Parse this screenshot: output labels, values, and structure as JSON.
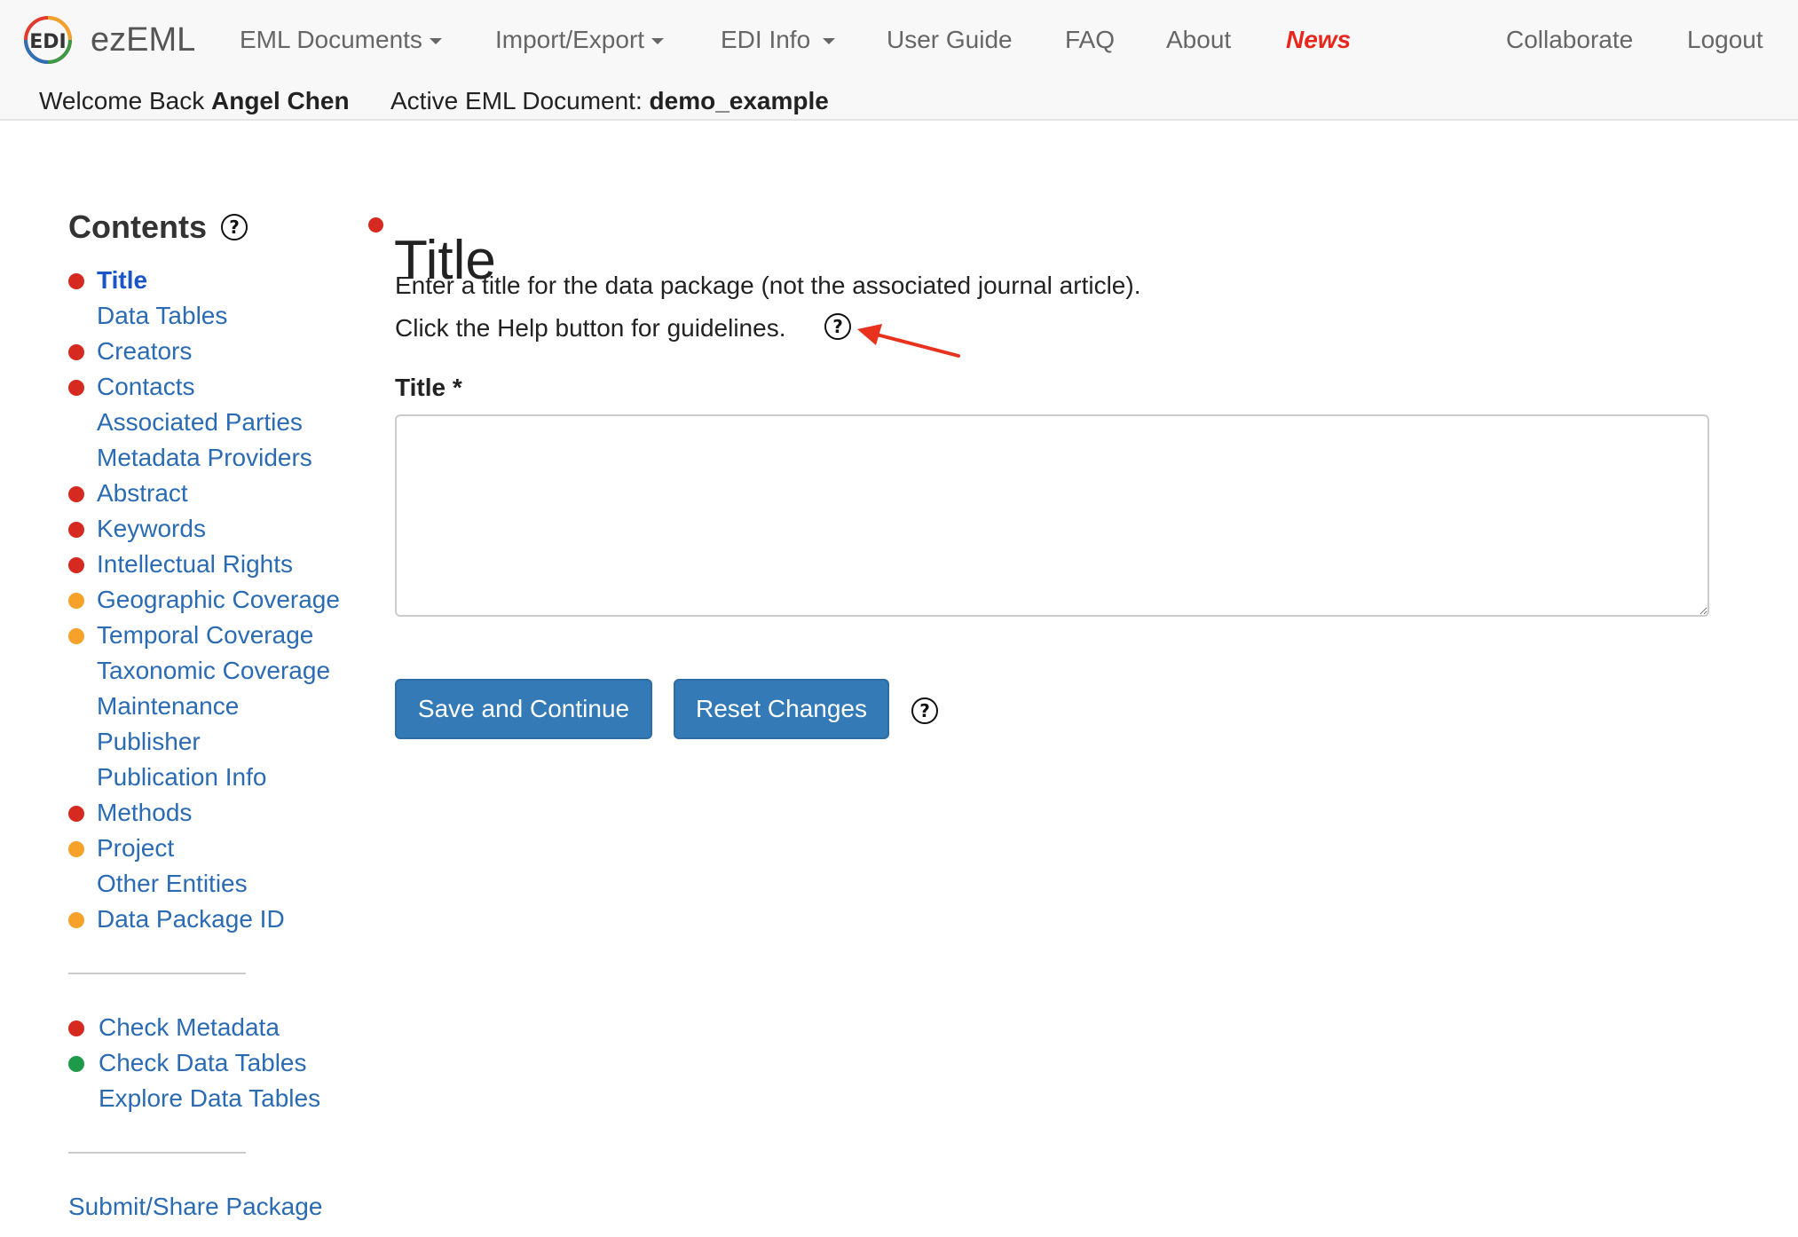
{
  "app": {
    "brand_name": "ezEML",
    "logo_text": "EDI"
  },
  "nav": {
    "eml_documents": "EML Documents",
    "import_export": "Import/Export",
    "edi_info": "EDI Info",
    "user_guide": "User Guide",
    "faq": "FAQ",
    "about": "About",
    "news": "News",
    "collaborate": "Collaborate",
    "logout": "Logout"
  },
  "session": {
    "welcome_prefix": "Welcome Back",
    "user_name": "Angel Chen",
    "active_doc_prefix": "Active EML Document:",
    "active_doc_name": "demo_example"
  },
  "sidebar": {
    "title": "Contents",
    "items": [
      {
        "label": "Title",
        "status": "red",
        "active": true
      },
      {
        "label": "Data Tables",
        "status": "none"
      },
      {
        "label": "Creators",
        "status": "red"
      },
      {
        "label": "Contacts",
        "status": "red"
      },
      {
        "label": "Associated Parties",
        "status": "none"
      },
      {
        "label": "Metadata Providers",
        "status": "none"
      },
      {
        "label": "Abstract",
        "status": "red"
      },
      {
        "label": "Keywords",
        "status": "red"
      },
      {
        "label": "Intellectual Rights",
        "status": "red"
      },
      {
        "label": "Geographic Coverage",
        "status": "orange"
      },
      {
        "label": "Temporal Coverage",
        "status": "orange"
      },
      {
        "label": "Taxonomic Coverage",
        "status": "none"
      },
      {
        "label": "Maintenance",
        "status": "none"
      },
      {
        "label": "Publisher",
        "status": "none"
      },
      {
        "label": "Publication Info",
        "status": "none"
      },
      {
        "label": "Methods",
        "status": "red"
      },
      {
        "label": "Project",
        "status": "orange"
      },
      {
        "label": "Other Entities",
        "status": "none"
      },
      {
        "label": "Data Package ID",
        "status": "orange"
      }
    ],
    "checks": [
      {
        "label": "Check Metadata",
        "status": "red"
      },
      {
        "label": "Check Data Tables",
        "status": "green"
      },
      {
        "label": "Explore Data Tables",
        "status": "none"
      }
    ],
    "submit_label": "Submit/Share Package"
  },
  "main": {
    "page_title": "Title",
    "instruction_1": "Enter a title for the data package (not the associated journal article).",
    "instruction_2": "Click the Help button for guidelines.",
    "field_label": "Title *",
    "title_value": "",
    "save_label": "Save and Continue",
    "reset_label": "Reset Changes"
  },
  "colors": {
    "red": "#d62a20",
    "orange": "#f5a12a",
    "green": "#1f9a48",
    "link": "#2a6bb3",
    "button": "#337ab7",
    "news": "#e8261e",
    "annotation_arrow": "#e8321e"
  },
  "icons": {
    "help": "?"
  }
}
